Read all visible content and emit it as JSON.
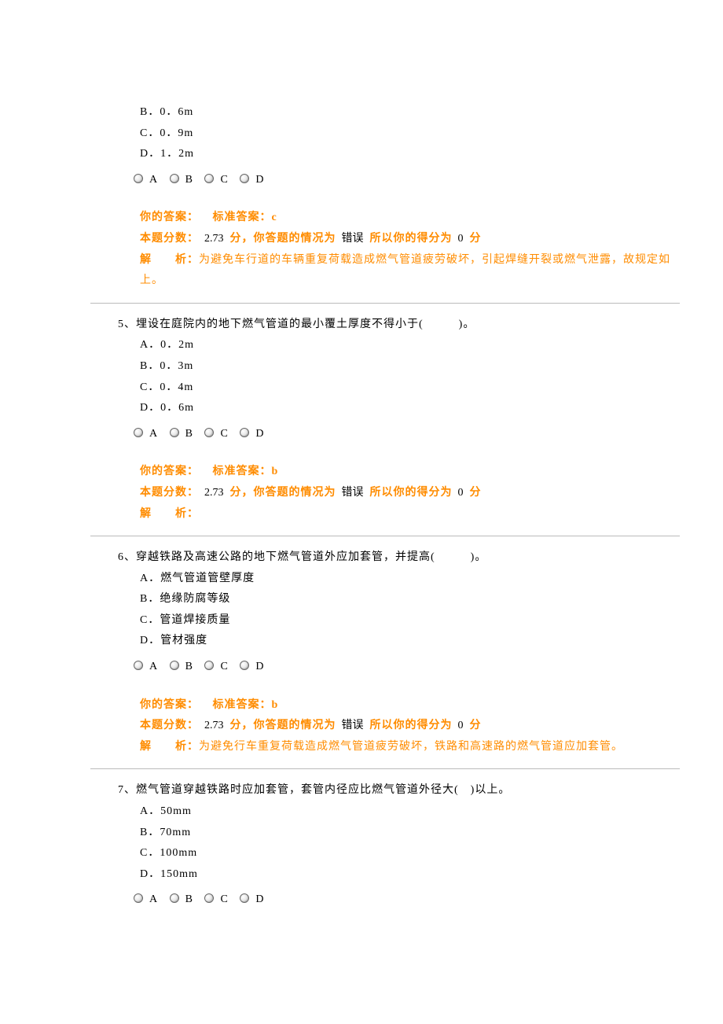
{
  "q4": {
    "opts": {
      "B": "B．0．6m",
      "C": "C．0．9m",
      "D": "D．1．2m"
    },
    "radios": [
      "A",
      "B",
      "C",
      "D"
    ],
    "your_ans_label": "你的答案：",
    "std_ans_label": "标准答案：",
    "std_ans": "c",
    "score_prefix": "本题分数：",
    "score_points": "2.73",
    "score_unit": "分，你答题的情况为",
    "status": "错误",
    "after_status1": "所以你的得分为",
    "gained": "0",
    "after_status2": "分",
    "jx_label": "解　　析：",
    "jx_text": "为避免车行道的车辆重复荷载造成燃气管道疲劳破坏，引起焊缝开裂或燃气泄露，故规定如上。"
  },
  "q5": {
    "num": "5、",
    "stem": "埋设在庭院内的地下燃气管道的最小覆土厚度不得小于(　　　)。",
    "opts": {
      "A": "A．0．2m",
      "B": "B．0．3m",
      "C": "C．0．4m",
      "D": "D．0．6m"
    },
    "radios": [
      "A",
      "B",
      "C",
      "D"
    ],
    "your_ans_label": "你的答案：",
    "std_ans_label": "标准答案：",
    "std_ans": "b",
    "score_prefix": "本题分数：",
    "score_points": "2.73",
    "score_unit": "分，你答题的情况为",
    "status": "错误",
    "after_status1": "所以你的得分为",
    "gained": "0",
    "after_status2": "分",
    "jx_label": "解　　析：",
    "jx_text": ""
  },
  "q6": {
    "num": "6、",
    "stem": "穿越铁路及高速公路的地下燃气管道外应加套管，并提高(　　　)。",
    "opts": {
      "A": "A．燃气管道管壁厚度",
      "B": "B．绝缘防腐等级",
      "C": "C．管道焊接质量",
      "D": "D．管材强度"
    },
    "radios": [
      "A",
      "B",
      "C",
      "D"
    ],
    "your_ans_label": "你的答案：",
    "std_ans_label": "标准答案：",
    "std_ans": "b",
    "score_prefix": "本题分数：",
    "score_points": "2.73",
    "score_unit": "分，你答题的情况为",
    "status": "错误",
    "after_status1": "所以你的得分为",
    "gained": "0",
    "after_status2": "分",
    "jx_label": "解　　析：",
    "jx_text": "为避免行车重复荷载造成燃气管道疲劳破坏，铁路和高速路的燃气管道应加套管。"
  },
  "q7": {
    "num": "7、",
    "stem": "燃气管道穿越铁路时应加套管，套管内径应比燃气管道外径大(　)以上。",
    "opts": {
      "A": "A．50mm",
      "B": "B．70mm",
      "C": "C．100mm",
      "D": "D．150mm"
    },
    "radios": [
      "A",
      "B",
      "C",
      "D"
    ]
  }
}
